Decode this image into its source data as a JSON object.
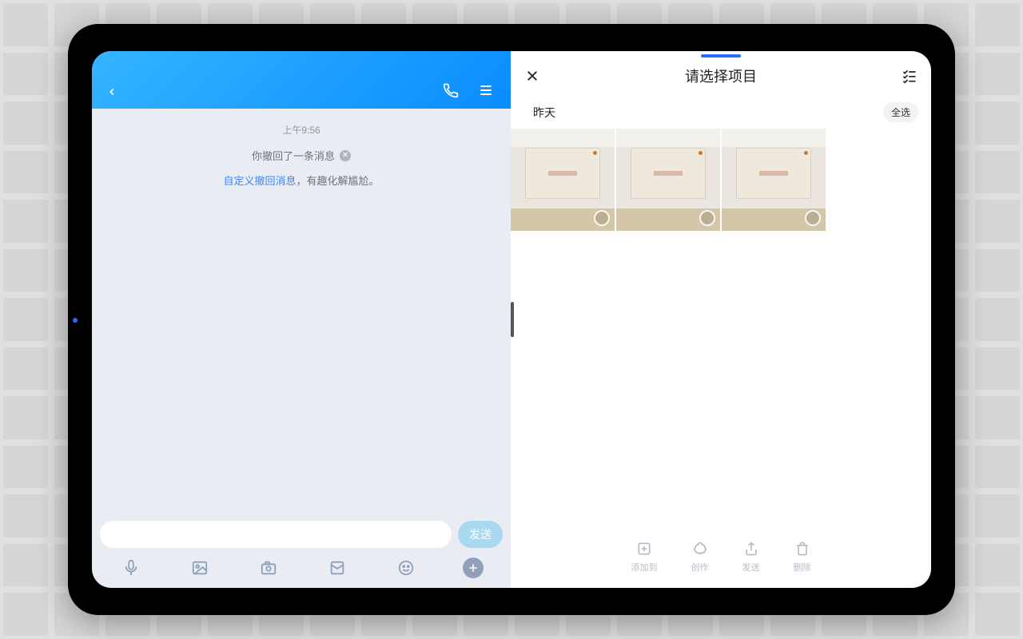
{
  "chat": {
    "timestamp": "上午9:56",
    "recall_text": "你撤回了一条消息",
    "tip_link": "自定义撤回消息",
    "tip_rest": "，有趣化解尴尬。",
    "send_label": "发送"
  },
  "picker": {
    "title": "请选择项目",
    "date_label": "昨天",
    "select_all_label": "全选",
    "actions": {
      "add_to": "添加到",
      "create": "创作",
      "send": "发送",
      "delete": "删除"
    }
  }
}
